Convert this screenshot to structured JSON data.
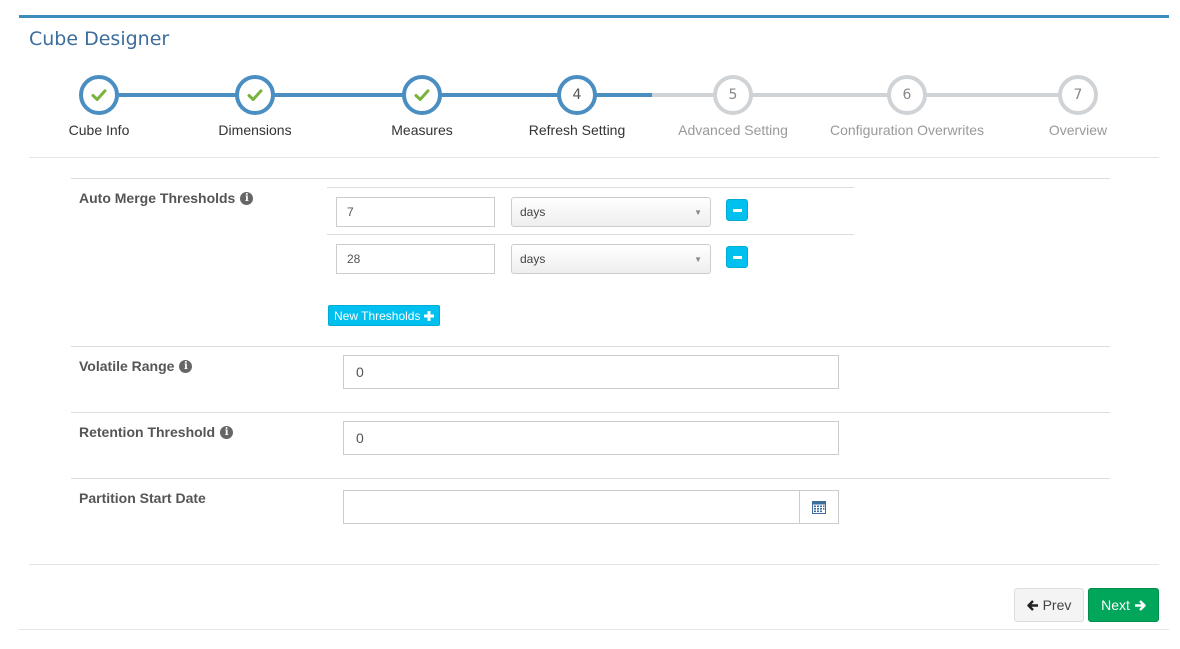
{
  "header": {
    "title": "Cube Designer"
  },
  "wizard": {
    "steps": [
      {
        "num": "1",
        "label": "Cube Info",
        "state": "done"
      },
      {
        "num": "2",
        "label": "Dimensions",
        "state": "done"
      },
      {
        "num": "3",
        "label": "Measures",
        "state": "done"
      },
      {
        "num": "4",
        "label": "Refresh Setting",
        "state": "active"
      },
      {
        "num": "5",
        "label": "Advanced Setting",
        "state": "todo"
      },
      {
        "num": "6",
        "label": "Configuration Overwrites",
        "state": "todo"
      },
      {
        "num": "7",
        "label": "Overview",
        "state": "todo"
      }
    ],
    "colors": {
      "complete": "#4a8ec2",
      "incomplete": "#d0d3d6",
      "check": "#7ab33c"
    }
  },
  "form": {
    "auto_merge": {
      "label": "Auto Merge Thresholds",
      "thresholds": [
        {
          "value": "7",
          "unit": "days"
        },
        {
          "value": "28",
          "unit": "days"
        }
      ],
      "new_button": "New Thresholds"
    },
    "volatile_range": {
      "label": "Volatile Range",
      "value": "0"
    },
    "retention_threshold": {
      "label": "Retention Threshold",
      "value": "0"
    },
    "partition_start_date": {
      "label": "Partition Start Date",
      "value": ""
    }
  },
  "footer": {
    "prev_label": "Prev",
    "next_label": "Next"
  },
  "icons": {
    "info": "info-circle-icon",
    "calendar": "calendar-icon",
    "prev": "arrow-left-icon",
    "next": "arrow-right-icon",
    "remove": "minus-icon",
    "add": "plus-icon"
  }
}
